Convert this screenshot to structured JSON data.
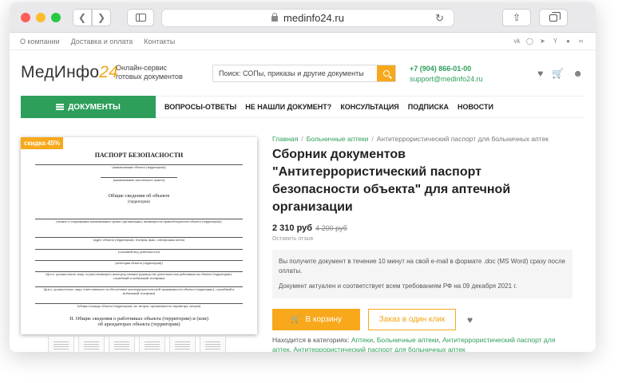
{
  "browser": {
    "url": "medinfo24.ru"
  },
  "topbar": {
    "links": [
      "О компании",
      "Доставка и оплата",
      "Контакты"
    ],
    "socials": [
      "vk-icon",
      "instagram-icon",
      "telegram-icon",
      "yandex-icon",
      "odnoklassniki-icon",
      "ok-icon"
    ]
  },
  "header": {
    "logo_main": "МедИнфо",
    "logo_accent": "24",
    "tagline": "Онлайн-сервис готовых документов",
    "search_placeholder": "Поиск: СОПы, приказы и другие документы",
    "phone": "+7 (904) 866-01-00",
    "email": "support@medinfo24.ru"
  },
  "menu": {
    "docs_label": "ДОКУМЕНТЫ",
    "items": [
      "ВОПРОСЫ-ОТВЕТЫ",
      "НЕ НАШЛИ ДОКУМЕНТ?",
      "КОНСУЛЬТАЦИЯ",
      "ПОДПИСКА",
      "НОВОСТИ"
    ]
  },
  "preview": {
    "discount": "скидка 45%",
    "doc_title": "ПАСПОРТ БЕЗОПАСНОСТИ",
    "line1": "(наименование объекта (территории))",
    "line2": "(наименование населенного пункта)",
    "section1": "Общие сведения об объекте",
    "section1_sub": "(территории)",
    "cap1": "(полное и сокращенное наименование органа (организации), являющегося правообладателем объекта (территории))",
    "cap2": "(адрес объекта (территории), телефон, факс, электронная почта)",
    "cap3": "(основной вид деятельности)",
    "cap4": "(категория объекта (территории))",
    "cap5": "(ф.и.о. должностного лица, осуществляющего непосредственное руководство деятельностью работников на объекте (территории), служебный и мобильный телефоны)",
    "cap6": "(ф.и.о. должностного лица, ответственного за обеспечение антитеррористической защищенности объекта (территории), служебный и мобильный телефоны)",
    "cap7": "(общая площадь объекта (территории), кв. метров, протяженность периметра, метров)",
    "section2": "II. Общие сведения о работниках объекта (территории) и (или) об арендаторах объекта (территории)"
  },
  "product": {
    "breadcrumb": [
      "Главная",
      "Больничные аптеки",
      "Антитеррористический паспорт для больничных аптек"
    ],
    "title": "Сборник документов \"Антитеррористический паспорт безопасности объекта\" для аптечной организации",
    "price": "2 310 руб",
    "old_price": "4 200 руб",
    "review_link": "Оставить отзыв",
    "notice1": "Вы получите документ в течение 10 минут на свой e-mail в формате .doc (MS Word) сразу после оплаты.",
    "notice2": "Документ актуален и соответствует всем требованиям РФ на 09 декабря 2021 г.",
    "cart_label": "В корзину",
    "oneclick_label": "Заказ в один клик",
    "categories_label": "Находится в категориях:",
    "categories": [
      "Аптеки",
      "Больничные аптеки",
      "Антитеррористический паспорт для аптек",
      "Антитеррористический паспорт для больничных аптек"
    ]
  }
}
